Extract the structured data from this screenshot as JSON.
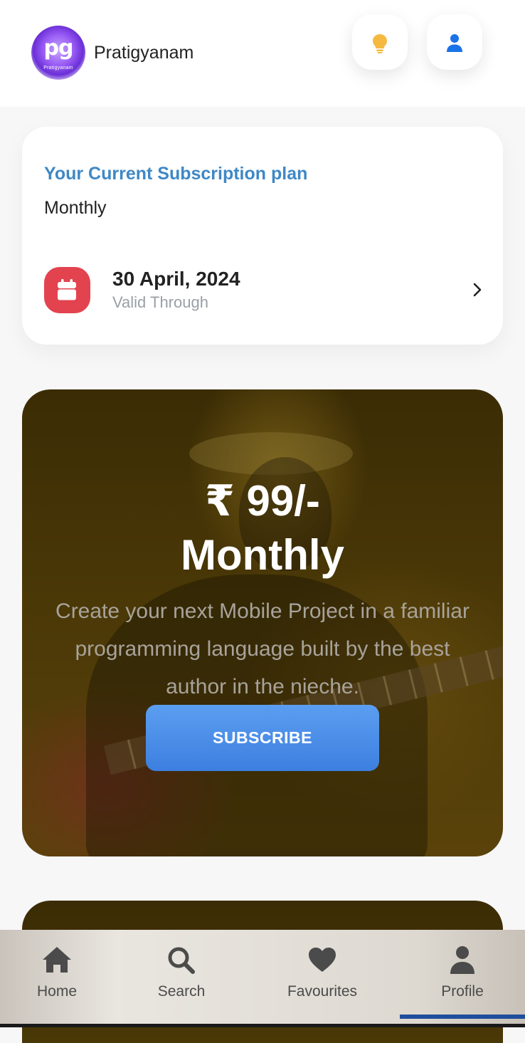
{
  "header": {
    "logo_text": "pg",
    "logo_subtext": "Pratigyanam",
    "app_name": "Pratigyanam",
    "icons": [
      "lightbulb-icon",
      "user-icon"
    ]
  },
  "subscription": {
    "title": "Your Current Subscription plan",
    "plan": "Monthly",
    "valid_date": "30 April, 2024",
    "valid_label": "Valid Through"
  },
  "promo": {
    "price": "₹ 99/-",
    "period": "Monthly",
    "description": "Create your next Mobile Project in a familiar programming language built by the best author in the nieche.",
    "button_label": "SUBSCRIBE"
  },
  "bottom_nav": {
    "items": [
      {
        "label": "Home",
        "icon": "home-icon"
      },
      {
        "label": "Search",
        "icon": "search-icon"
      },
      {
        "label": "Favourites",
        "icon": "heart-icon"
      },
      {
        "label": "Profile",
        "icon": "user-icon"
      }
    ],
    "active": "Profile"
  },
  "colors": {
    "accent_blue": "#3f88c5",
    "calendar_red": "#e2434f",
    "bulb_yellow": "#f5b942",
    "button_blue": "#4a8ce8",
    "nav_indicator": "#1f4e9c"
  }
}
